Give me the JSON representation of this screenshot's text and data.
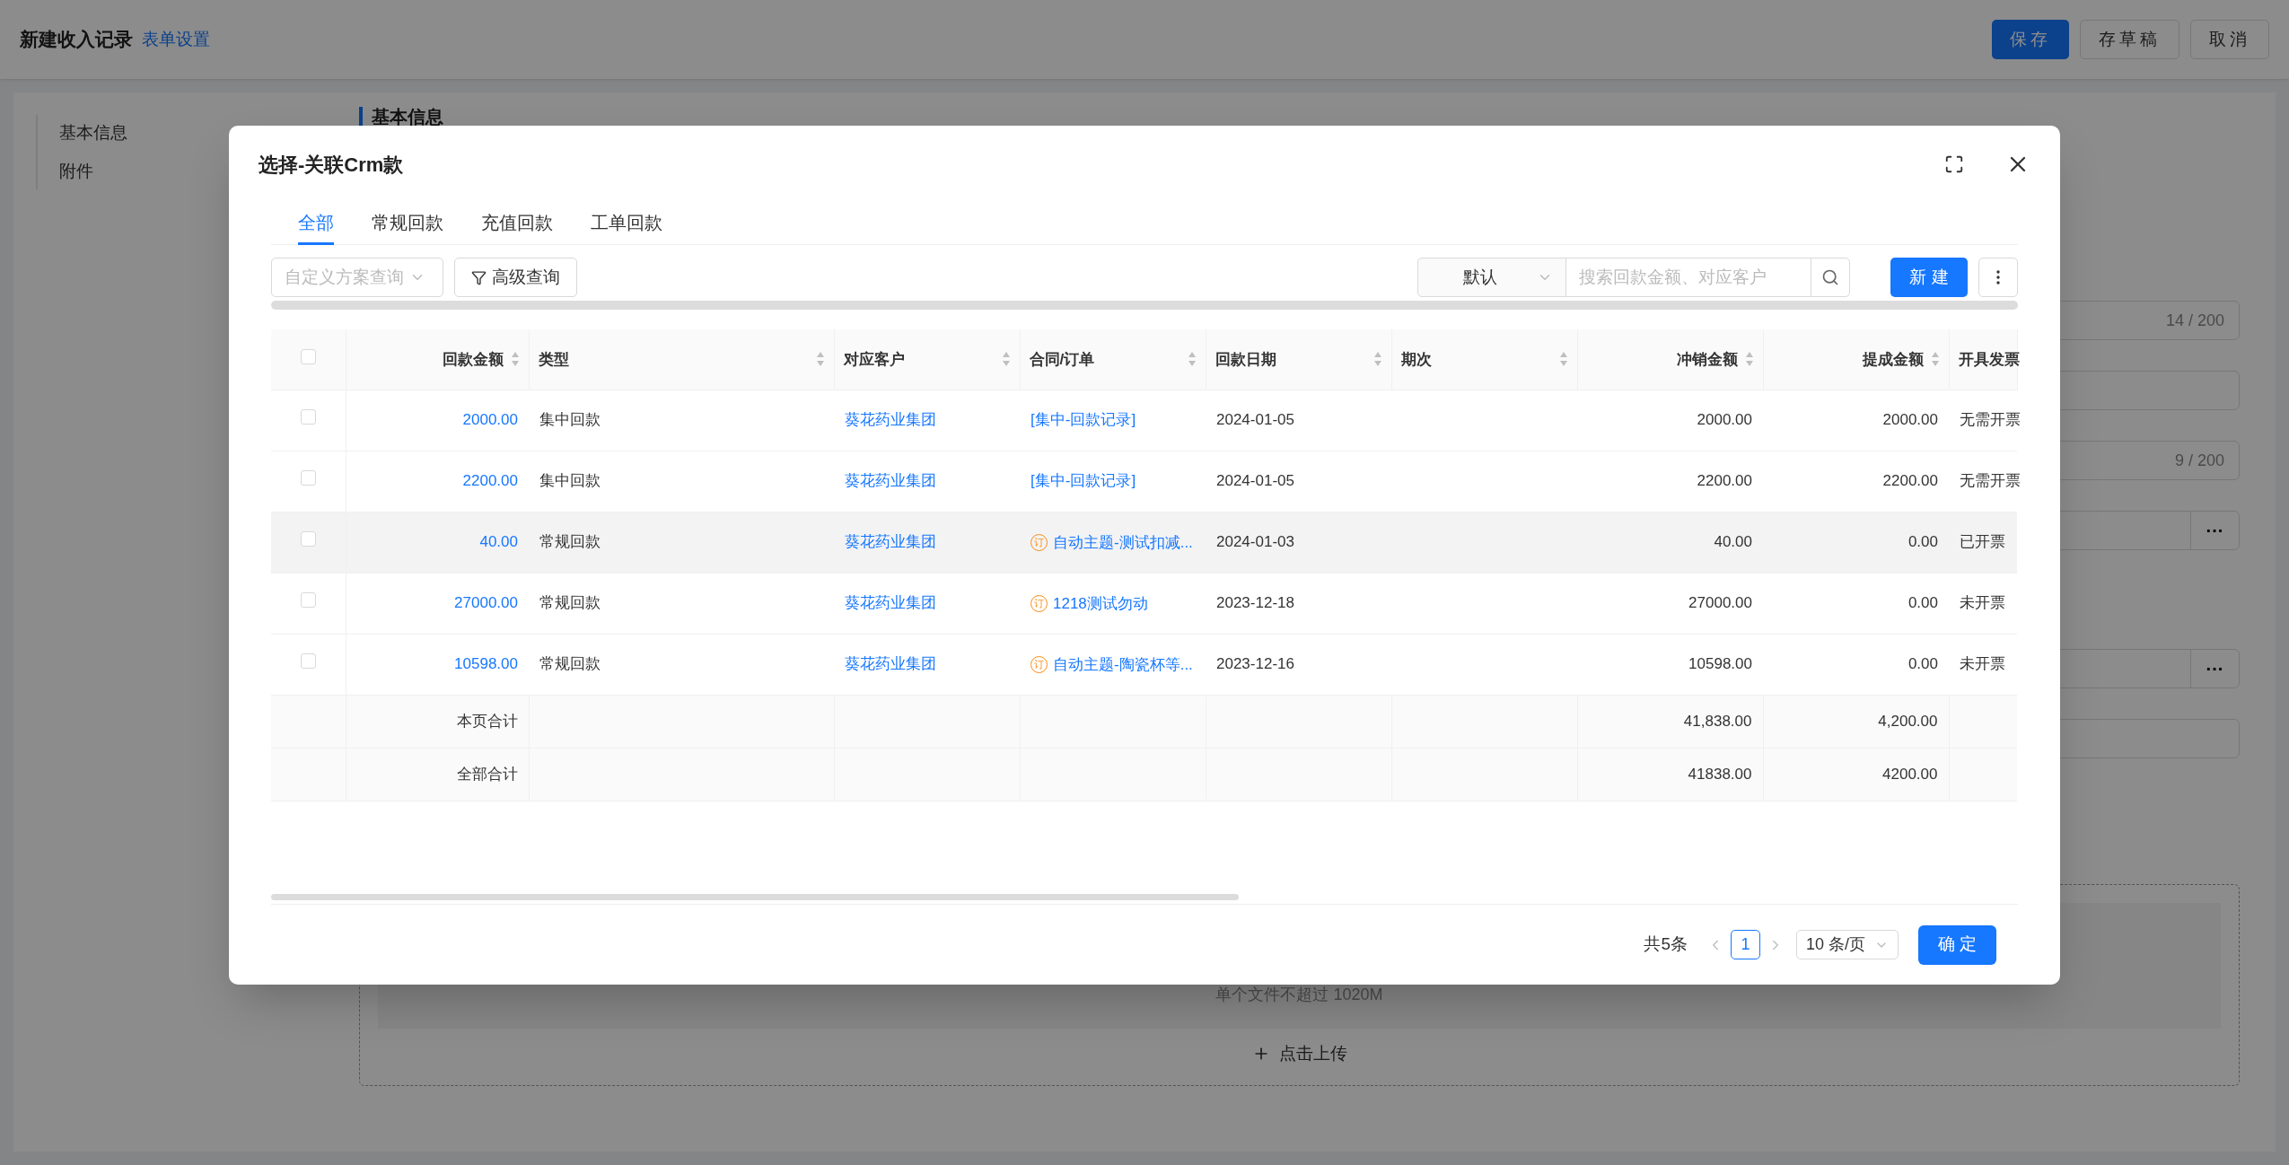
{
  "page": {
    "title": "新建收入记录",
    "settings_link": "表单设置",
    "buttons": [
      {
        "label": "保存",
        "kind": "primary"
      },
      {
        "label": "存草稿",
        "kind": "default"
      },
      {
        "label": "取消",
        "kind": "default"
      }
    ]
  },
  "nav": {
    "items": [
      "基本信息",
      "附件"
    ]
  },
  "form": {
    "section_title": "基本信息",
    "groups": [
      [
        {
          "kind": "counter",
          "counter": "14 / 200"
        },
        {
          "kind": "plain"
        },
        {
          "kind": "counter",
          "counter": "9 / 200"
        },
        {
          "kind": "picker",
          "button": "···"
        }
      ],
      [
        {
          "kind": "picker",
          "button": "···"
        },
        {
          "kind": "plain"
        }
      ]
    ],
    "upload": {
      "hint": "单个文件不超过 1020M",
      "button": "点击上传"
    }
  },
  "dialog": {
    "title": "选择-关联Crm款",
    "tabs": [
      {
        "label": "全部",
        "selected": true
      },
      {
        "label": "常规回款",
        "selected": false
      },
      {
        "label": "充值回款",
        "selected": false
      },
      {
        "label": "工单回款",
        "selected": false
      }
    ],
    "toolbar": {
      "scheme_placeholder": "自定义方案查询",
      "advanced_button": "高级查询",
      "sort_select": "默认",
      "search_placeholder": "搜索回款金额、对应客户",
      "new_button": "新 建"
    },
    "table": {
      "all_checked": false,
      "columns": [
        {
          "label": "回款金额",
          "sortable": true
        },
        {
          "label": "类型",
          "sortable": true
        },
        {
          "label": "对应客户",
          "sortable": true
        },
        {
          "label": "合同/订单",
          "sortable": true
        },
        {
          "label": "回款日期",
          "sortable": true
        },
        {
          "label": "期次",
          "sortable": true
        },
        {
          "label": "冲销金额",
          "sortable": true
        },
        {
          "label": "提成金额",
          "sortable": true
        },
        {
          "label": "开具发票",
          "sortable": false
        }
      ],
      "rows": [
        {
          "checked": false,
          "highlighted": false,
          "cells": [
            {
              "kind": "link",
              "text": "2000.00"
            },
            {
              "kind": "text",
              "text": "集中回款"
            },
            {
              "kind": "link",
              "text": "葵花药业集团"
            },
            {
              "kind": "link",
              "text": "[集中-回款记录]"
            },
            {
              "kind": "text",
              "text": "2024-01-05"
            },
            {
              "kind": "empty"
            },
            {
              "kind": "text",
              "text": "2000.00"
            },
            {
              "kind": "text",
              "text": "2000.00"
            },
            {
              "kind": "text",
              "text": "无需开票"
            }
          ]
        },
        {
          "checked": false,
          "highlighted": false,
          "cells": [
            {
              "kind": "link",
              "text": "2200.00"
            },
            {
              "kind": "text",
              "text": "集中回款"
            },
            {
              "kind": "link",
              "text": "葵花药业集团"
            },
            {
              "kind": "link",
              "text": "[集中-回款记录]"
            },
            {
              "kind": "text",
              "text": "2024-01-05"
            },
            {
              "kind": "empty"
            },
            {
              "kind": "text",
              "text": "2200.00"
            },
            {
              "kind": "text",
              "text": "2200.00"
            },
            {
              "kind": "text",
              "text": "无需开票"
            }
          ]
        },
        {
          "checked": false,
          "highlighted": true,
          "cells": [
            {
              "kind": "link",
              "text": "40.00"
            },
            {
              "kind": "text",
              "text": "常规回款"
            },
            {
              "kind": "link",
              "text": "葵花药业集团"
            },
            {
              "kind": "order",
              "tag": "订",
              "text": "自动主题-测试扣减..."
            },
            {
              "kind": "text",
              "text": "2024-01-03"
            },
            {
              "kind": "empty"
            },
            {
              "kind": "text",
              "text": "40.00"
            },
            {
              "kind": "text",
              "text": "0.00"
            },
            {
              "kind": "text",
              "text": "已开票"
            }
          ]
        },
        {
          "checked": false,
          "highlighted": false,
          "cells": [
            {
              "kind": "link",
              "text": "27000.00"
            },
            {
              "kind": "text",
              "text": "常规回款"
            },
            {
              "kind": "link",
              "text": "葵花药业集团"
            },
            {
              "kind": "order",
              "tag": "订",
              "text": "1218测试勿动"
            },
            {
              "kind": "text",
              "text": "2023-12-18"
            },
            {
              "kind": "empty"
            },
            {
              "kind": "text",
              "text": "27000.00"
            },
            {
              "kind": "text",
              "text": "0.00"
            },
            {
              "kind": "text",
              "text": "未开票"
            }
          ]
        },
        {
          "checked": false,
          "highlighted": false,
          "cells": [
            {
              "kind": "link",
              "text": "10598.00"
            },
            {
              "kind": "text",
              "text": "常规回款"
            },
            {
              "kind": "link",
              "text": "葵花药业集团"
            },
            {
              "kind": "order",
              "tag": "订",
              "text": "自动主题-陶瓷杯等..."
            },
            {
              "kind": "text",
              "text": "2023-12-16"
            },
            {
              "kind": "empty"
            },
            {
              "kind": "text",
              "text": "10598.00"
            },
            {
              "kind": "text",
              "text": "0.00"
            },
            {
              "kind": "text",
              "text": "未开票"
            }
          ]
        }
      ],
      "totals": [
        {
          "label": "本页合计",
          "writeoff": "41,838.00",
          "commission": "4,200.00"
        },
        {
          "label": "全部合计",
          "writeoff": "41838.00",
          "commission": "4200.00"
        }
      ]
    },
    "pagination": {
      "total": "共5条",
      "pages": [
        {
          "label": "1",
          "selected": true
        }
      ],
      "page_size": "10 条/页"
    },
    "confirm_button": "确 定"
  }
}
